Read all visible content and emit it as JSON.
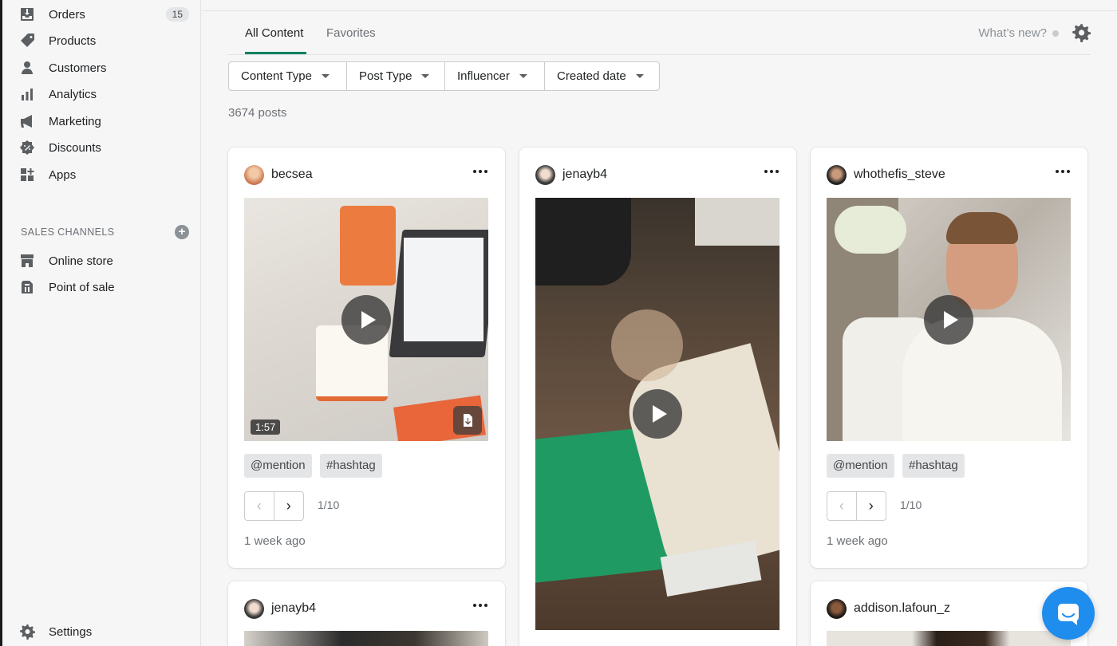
{
  "sidebar": {
    "items": [
      {
        "label": "Orders",
        "icon": "orders-icon",
        "badge": "15"
      },
      {
        "label": "Products",
        "icon": "tag-icon"
      },
      {
        "label": "Customers",
        "icon": "person-icon"
      },
      {
        "label": "Analytics",
        "icon": "bar-chart-icon"
      },
      {
        "label": "Marketing",
        "icon": "megaphone-icon"
      },
      {
        "label": "Discounts",
        "icon": "discount-icon"
      },
      {
        "label": "Apps",
        "icon": "apps-icon"
      }
    ],
    "channels_title": "SALES CHANNELS",
    "channels": [
      {
        "label": "Online store",
        "icon": "store-icon"
      },
      {
        "label": "Point of sale",
        "icon": "pos-icon"
      }
    ],
    "settings_label": "Settings"
  },
  "header": {
    "tabs": [
      {
        "label": "All Content"
      },
      {
        "label": "Favorites"
      }
    ],
    "whats_new": "What’s new?"
  },
  "filters": [
    {
      "label": "Content Type"
    },
    {
      "label": "Post Type"
    },
    {
      "label": "Influencer"
    },
    {
      "label": "Created date"
    }
  ],
  "post_count": "3674 posts",
  "posts": [
    {
      "username": "becsea",
      "duration": "1:57",
      "tags": [
        "@mention",
        "#hashtag"
      ],
      "page": "1/10",
      "time_ago": "1 week ago"
    },
    {
      "username": "jenayb4"
    },
    {
      "username": "whothefis_steve",
      "tags": [
        "@mention",
        "#hashtag"
      ],
      "page": "1/10",
      "time_ago": "1 week ago"
    },
    {
      "username": "jenayb4"
    },
    {
      "username": "addison.lafoun_z"
    }
  ],
  "colors": {
    "accent": "#008060",
    "chat": "#1f8ded"
  }
}
